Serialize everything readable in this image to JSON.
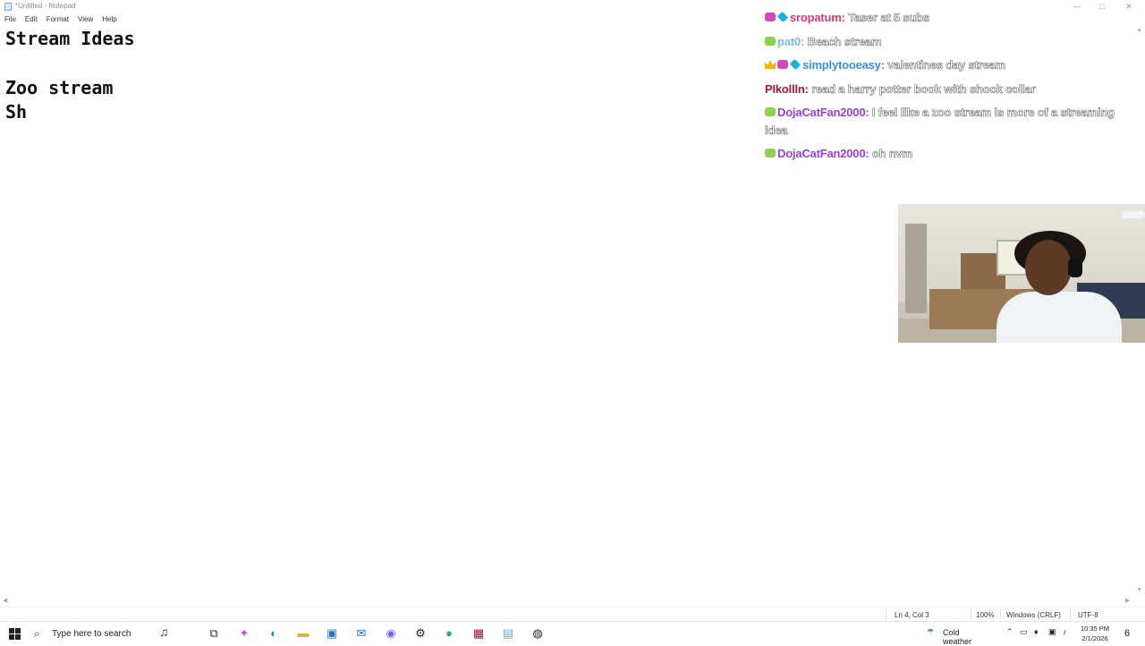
{
  "window": {
    "title": "*Untitled - Notepad",
    "controls": {
      "minimize": "—",
      "maximize": "□",
      "close": "✕"
    }
  },
  "menu": [
    "File",
    "Edit",
    "Format",
    "View",
    "Help"
  ],
  "editor": {
    "lines": [
      "Stream Ideas",
      "",
      "Zoo stream",
      "Sh"
    ]
  },
  "statusbar": {
    "position": "Ln 4, Col 3",
    "zoom": "100%",
    "line_ending": "Windows (CRLF)",
    "encoding": "UTF-8"
  },
  "chat": {
    "messages": [
      {
        "badges": [
          "pink",
          "cyan"
        ],
        "user": "sropatum",
        "user_color": "#d23a7a",
        "text": "Taser at 5 subs"
      },
      {
        "badges": [
          "green"
        ],
        "user": "pat0",
        "user_color": "#7fb4e6",
        "text": "Beach stream"
      },
      {
        "badges": [
          "crown",
          "pink",
          "cyan"
        ],
        "user": "simplytooeasy",
        "user_color": "#3b8fd6",
        "text": "valentines day stream"
      },
      {
        "badges": [],
        "user": "PIkollln",
        "user_color": "#9b1a3e",
        "text": "read a harry potter book with shock collar"
      },
      {
        "badges": [
          "green"
        ],
        "user": "DojaCatFan2000",
        "user_color": "#9a3fd1",
        "text": "I feel like a zoo stream is more of a streaming idea"
      },
      {
        "badges": [
          "green"
        ],
        "user": "DojaCatFan2000",
        "user_color": "#9a3fd1",
        "text": "oh nvm"
      }
    ]
  },
  "taskbar": {
    "search_placeholder": "Type here to search",
    "weather": "Cold weather",
    "time": "10:35 PM",
    "date": "2/1/2026",
    "notification_count": "6",
    "apps": [
      "task-view-icon",
      "copilot-icon",
      "edge-icon",
      "file-explorer-icon",
      "store-icon",
      "outlook-icon",
      "discord-icon",
      "steam-icon",
      "spotify-icon",
      "winrar-icon",
      "notepad-icon",
      "obs-icon"
    ]
  }
}
